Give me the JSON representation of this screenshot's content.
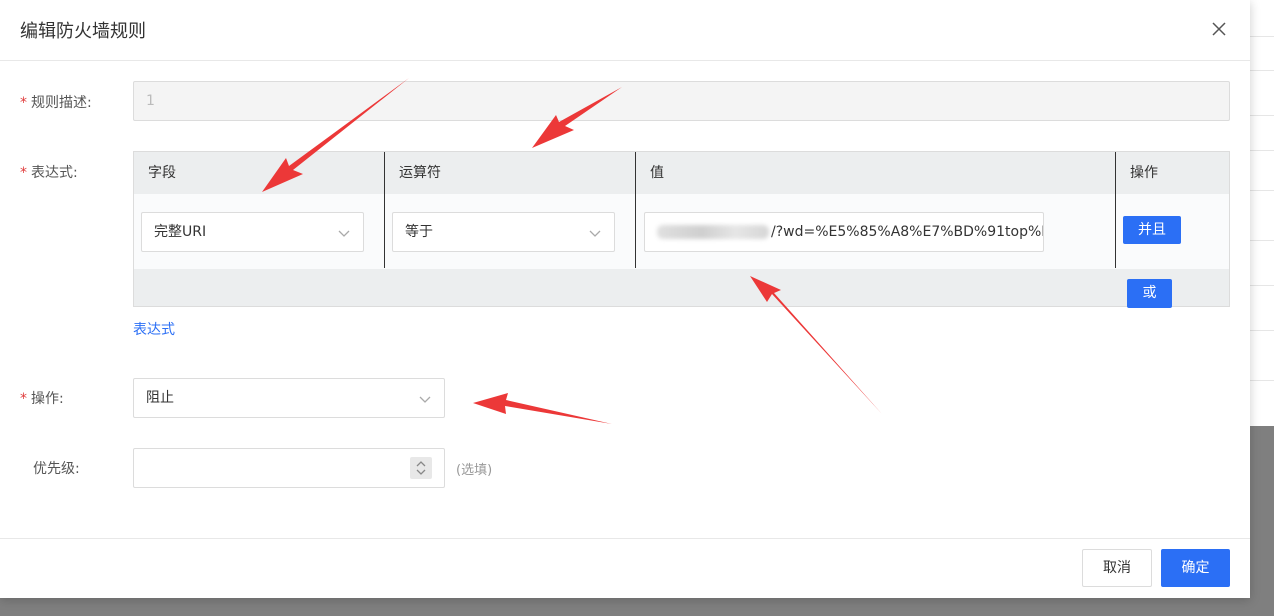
{
  "dialog": {
    "title": "编辑防火墙规则"
  },
  "form": {
    "description": {
      "label": "规则描述:",
      "value": "1"
    },
    "expression": {
      "label": "表达式:",
      "columns": [
        "字段",
        "运算符",
        "值",
        "操作"
      ],
      "row": {
        "field": "完整URI",
        "operator": "等于",
        "value_visible": "/?wd=%E5%85%A8%E7%BD%91top%E",
        "and_button": "并且"
      },
      "or_button": "或",
      "add_link": "表达式"
    },
    "action": {
      "label": "操作:",
      "value": "阻止"
    },
    "priority": {
      "label": "优先级:",
      "hint": "(选填)"
    }
  },
  "footer": {
    "cancel": "取消",
    "confirm": "确定"
  },
  "colors": {
    "primary": "#2b6ff5",
    "required": "#e03b3b",
    "annotation_arrow": "#ec3838"
  },
  "icons": [
    "close-icon",
    "chevron-down-icon",
    "spinner-icon",
    "annotation-arrow"
  ]
}
